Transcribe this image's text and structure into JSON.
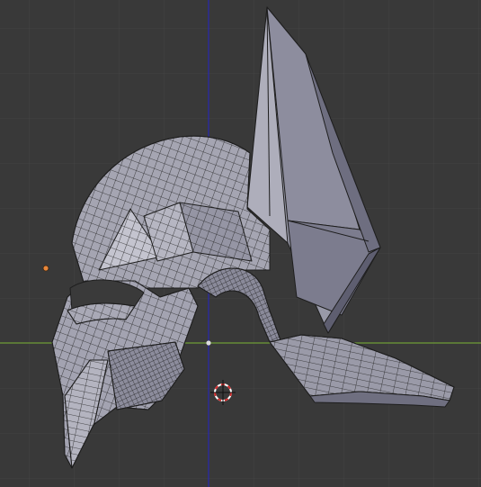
{
  "viewport": {
    "name": "3d-viewport",
    "background": "#393939",
    "grid_color": "#444444",
    "axis_x_color": "#6f9d37",
    "axis_y_color": "#2a2aa8"
  },
  "object": {
    "name": "helmet-mesh",
    "face_color": "#9d9daa",
    "face_shadow": "#6e6e7e",
    "face_highlight": "#c4c4cf",
    "wire_color": "#1e1e1e"
  },
  "origin_marker": {
    "color": "#e8873a"
  },
  "cursor_3d": {
    "ring_color_a": "#d42a2a",
    "ring_color_b": "#ffffff",
    "crosshair_color": "#111111"
  },
  "pivot_point": {
    "color": "#dcdcdc"
  }
}
